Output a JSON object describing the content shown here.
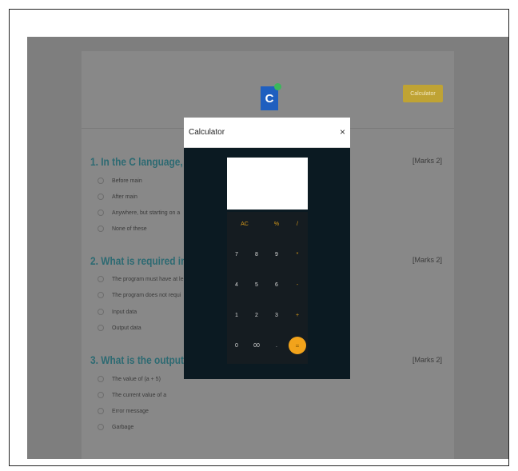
{
  "header": {
    "logo_text": "C",
    "calculator_button": "Calculator"
  },
  "questions": [
    {
      "title": "1. In the C language, th",
      "marks": "[Marks 2]",
      "options": [
        "Before main",
        "After main",
        "Anywhere, but starting on a",
        "None of these"
      ]
    },
    {
      "title": "2. What is required in C",
      "marks": "[Marks 2]",
      "options": [
        "The program must have at le",
        "The program does not requi",
        "Input data",
        "Output data"
      ]
    },
    {
      "title": "3. What is the output c",
      "marks": "[Marks 2]",
      "options": [
        "The value of (a + 5)",
        "The current value of a",
        "Error message",
        "Garbage"
      ]
    }
  ],
  "calculator": {
    "title": "Calculator",
    "close": "×",
    "display_value": "",
    "keys": {
      "ac": "AC",
      "percent": "%",
      "divide": "/",
      "k7": "7",
      "k8": "8",
      "k9": "9",
      "multiply": "*",
      "k4": "4",
      "k5": "5",
      "k6": "6",
      "minus": "-",
      "k1": "1",
      "k2": "2",
      "k3": "3",
      "plus": "+",
      "k0": "0",
      "k00": "00",
      "dot": ".",
      "equals": "="
    }
  }
}
